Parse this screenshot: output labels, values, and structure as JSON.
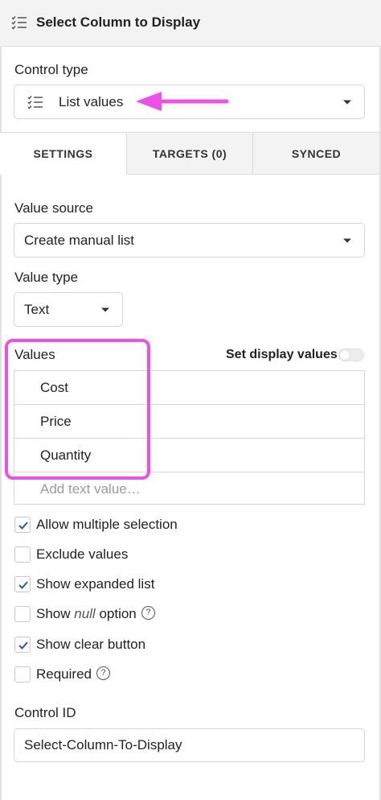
{
  "header": {
    "title": "Select Column to Display",
    "icon": "list-icon"
  },
  "control_type": {
    "label": "Control type",
    "value": "List values",
    "icon": "list-icon"
  },
  "tabs": [
    {
      "label": "SETTINGS",
      "active": true
    },
    {
      "label": "TARGETS (0)",
      "active": false
    },
    {
      "label": "SYNCED",
      "active": false
    }
  ],
  "value_source": {
    "label": "Value source",
    "value": "Create manual list"
  },
  "value_type": {
    "label": "Value type",
    "value": "Text"
  },
  "values": {
    "label": "Values",
    "display_toggle_label": "Set display values",
    "items": [
      "Cost",
      "Price",
      "Quantity"
    ],
    "add_placeholder": "Add text value…"
  },
  "checkboxes": [
    {
      "label": "Allow multiple selection",
      "checked": true
    },
    {
      "label": "Exclude values",
      "checked": false
    },
    {
      "label": "Show expanded list",
      "checked": true
    },
    {
      "label_pre": "Show ",
      "label_em": "null",
      "label_post": " option",
      "checked": false,
      "help": "?"
    },
    {
      "label": "Show clear button",
      "checked": true
    },
    {
      "label": "Required",
      "checked": false,
      "help": "?"
    }
  ],
  "control_id": {
    "label": "Control ID",
    "value": "Select-Column-To-Display"
  },
  "colors": {
    "highlight": "#ee4fe6",
    "check": "#2a56b8",
    "arrow": "#ee4fe6"
  }
}
